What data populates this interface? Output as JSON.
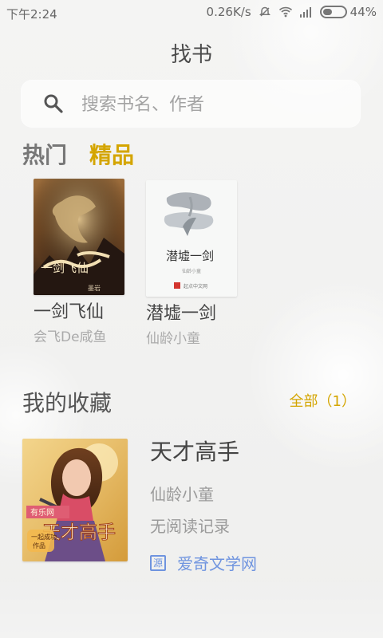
{
  "status_bar": {
    "time": "下午2:24",
    "network_speed": "0.26K/s",
    "battery_percent_text": "44%",
    "battery_level": 0.44,
    "icons": [
      "do-not-disturb-icon",
      "wifi-icon",
      "signal-icon",
      "battery-icon"
    ]
  },
  "header": {
    "title": "找书"
  },
  "search": {
    "placeholder": "搜索书名、作者",
    "icon": "search-icon"
  },
  "tabs": [
    {
      "label": "热门",
      "active": false
    },
    {
      "label": "精品",
      "active": true
    }
  ],
  "featured_books": [
    {
      "title": "一剑飞仙",
      "author": "会飞De咸鱼",
      "cover_text": "一剑飞仙"
    },
    {
      "title": "潜墟一剑",
      "author": "仙龄小童",
      "cover_text": "潜墟一剑"
    }
  ],
  "favorites": {
    "section_title": "我的收藏",
    "all_label": "全部（1）",
    "items": [
      {
        "title": "天才高手",
        "author": "仙龄小童",
        "progress": "无阅读记录",
        "source_icon_text": "源",
        "source": "爱奇文学网",
        "cover_text": "天才高手"
      }
    ]
  },
  "colors": {
    "accent": "#d4a500",
    "link_blue": "#6f94df",
    "text_dark": "#444444",
    "text_muted": "#9a9a9a",
    "background": "#f3f3f2"
  }
}
